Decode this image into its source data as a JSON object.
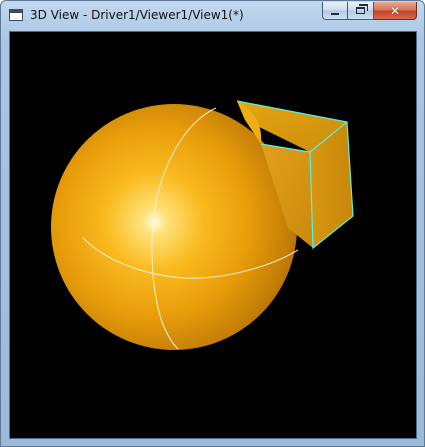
{
  "window": {
    "title": "3D View - Driver1/Viewer1/View1(*)",
    "icon": "window-app-icon"
  },
  "controls": {
    "minimize_icon": "minimize-icon",
    "maximize_icon": "maximize-icon",
    "close_icon": "close-icon"
  },
  "scene": {
    "background": "#000000",
    "sphere_color": "#f4a80f",
    "box_color": "#d99a10",
    "edge_color": "#4ff5e6",
    "seam_color": "#ffffff",
    "objects": [
      "sphere",
      "box"
    ]
  }
}
